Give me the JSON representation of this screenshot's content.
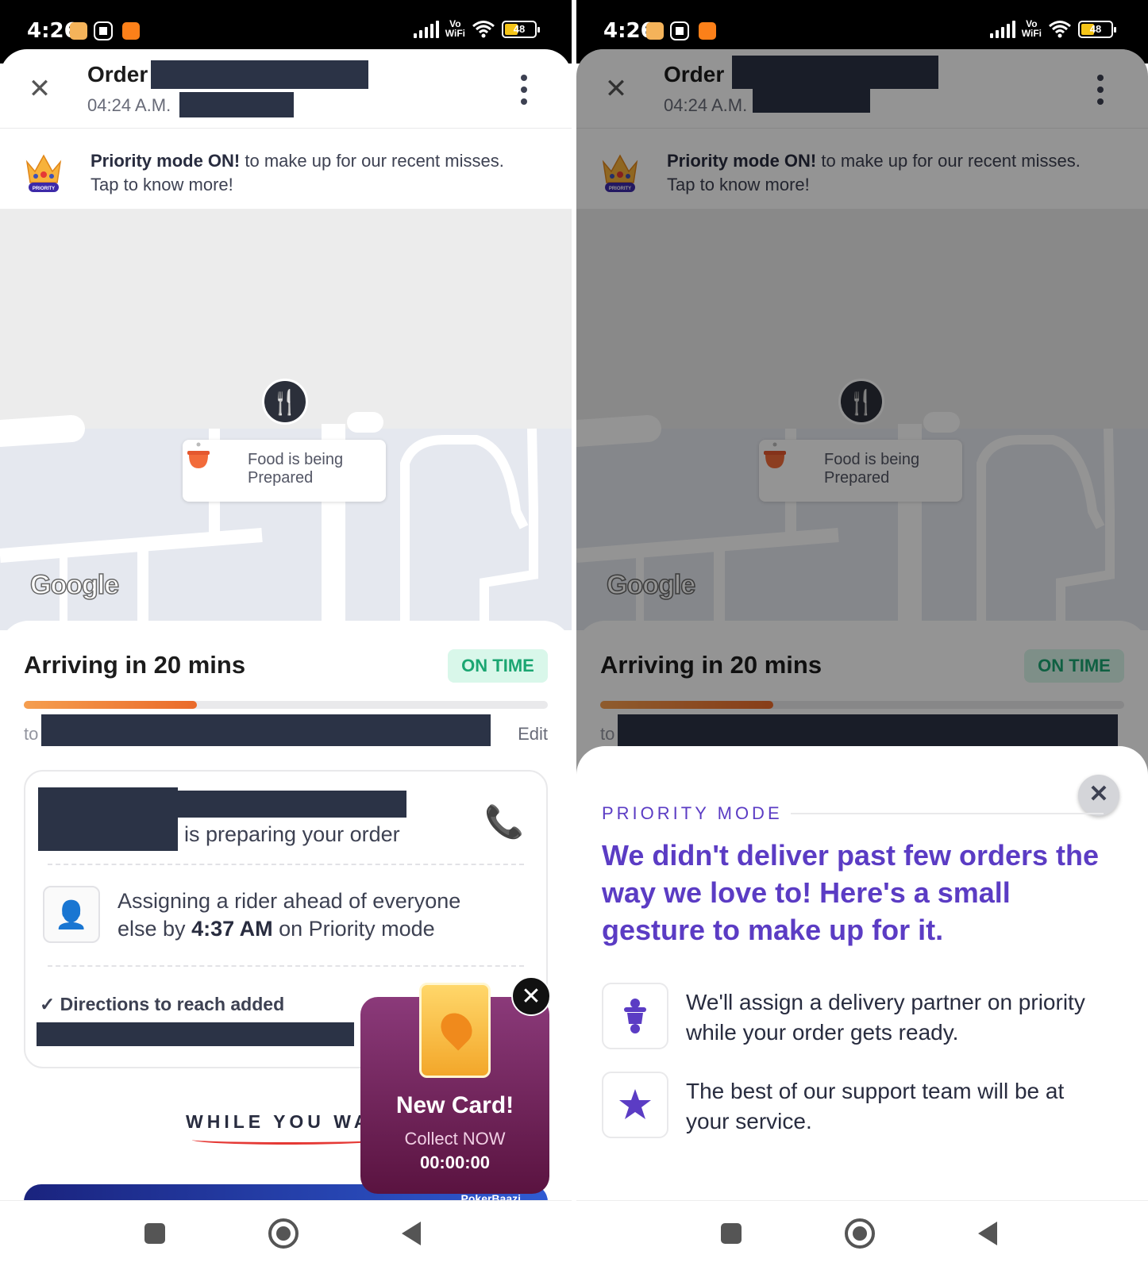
{
  "status_bar": {
    "time": "4:26",
    "vowifi_top": "Vo",
    "vowifi_bottom": "WiFi",
    "battery": "48",
    "icons": [
      "gallery-app-icon",
      "shield-app-icon",
      "swiggy-app-icon",
      "signal-icon",
      "wifi-icon",
      "battery-icon"
    ]
  },
  "header": {
    "title": "Order",
    "subtitle": "04:24 A.M.",
    "close_icon": "close-icon",
    "menu_icon": "more-vertical-icon"
  },
  "priority_banner": {
    "bold": "Priority mode ON!",
    "text": " to make up for our recent misses.",
    "line2": "Tap to know more!",
    "badge": "PRIORITY"
  },
  "map": {
    "logo": "Google",
    "pin_icon": "restaurant-pin-icon",
    "card_line1": "Food is being",
    "card_line2": "Prepared"
  },
  "delivery": {
    "title": "Arriving in 20 mins",
    "badge": "ON TIME",
    "progress": 0.33,
    "to_label": "to",
    "edit_label": "Edit"
  },
  "status_card": {
    "preparing_text": "is preparing your order",
    "rider_line1": "Assigning a rider ahead of everyone",
    "rider_prefix": "else by ",
    "rider_time": "4:37 AM",
    "rider_suffix": " on Priority mode",
    "directions": "✓ Directions to reach added"
  },
  "while_you_wait": {
    "label": "WHILE YOU WA",
    "promo_text": "PokerBaazi"
  },
  "new_card": {
    "title": "New Card!",
    "cta": "Collect NOW",
    "timer": "00:00:00"
  },
  "priority_modal": {
    "label": "PRIORITY MODE",
    "headline": "We didn't deliver past few orders the way we love to! Here's a small gesture to make up for it.",
    "items": [
      {
        "icon": "delivery-scooter-icon",
        "text": "We'll assign a delivery partner on priority while your order gets ready."
      },
      {
        "icon": "star-support-icon",
        "text": "The best of our support team will be at your service."
      }
    ]
  },
  "colors": {
    "accent_orange": "#fc6c1e",
    "ontime_green": "#1ba672",
    "priority_purple": "#5b3cc4"
  }
}
